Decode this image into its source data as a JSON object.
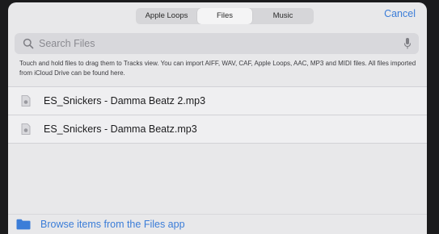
{
  "tabs": [
    {
      "label": "Apple Loops",
      "selected": false
    },
    {
      "label": "Files",
      "selected": true
    },
    {
      "label": "Music",
      "selected": false
    }
  ],
  "cancel_label": "Cancel",
  "search": {
    "placeholder": "Search Files",
    "value": ""
  },
  "info_text": "Touch and hold files to drag them to Tracks view. You can import AIFF, WAV, CAF, Apple Loops, AAC, MP3 and MIDI files. All files imported from iCloud Drive can be found here.",
  "files": [
    {
      "name": "ES_Snickers - Damma Beatz 2.mp3",
      "icon": "audio-file-icon"
    },
    {
      "name": "ES_Snickers - Damma Beatz.mp3",
      "icon": "audio-file-icon"
    }
  ],
  "browse_label": "Browse items from the Files app",
  "colors": {
    "accent": "#3b7dd8",
    "panel": "#e8e8ea",
    "background": "#1b1b1d"
  }
}
